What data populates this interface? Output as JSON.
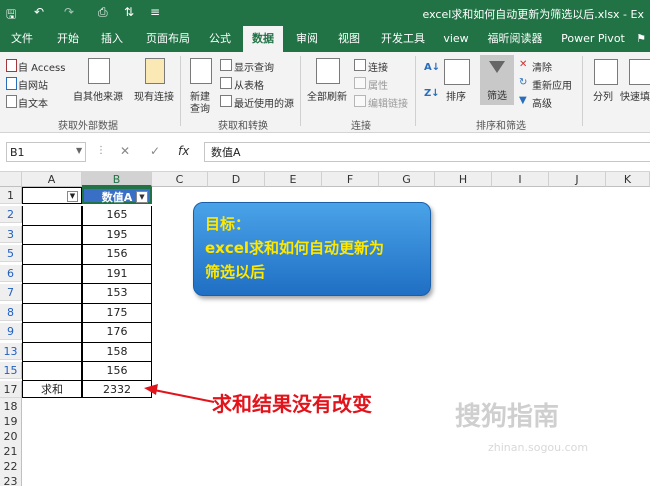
{
  "title_bar": {
    "title": "excel求和如何自动更新为筛选以后.xlsx - Ex"
  },
  "tabs": [
    "文件",
    "开始",
    "插入",
    "页面布局",
    "公式",
    "数据",
    "审阅",
    "视图",
    "开发工具",
    "view",
    "福昕阅读器",
    "Power Pivot"
  ],
  "active_tab": "数据",
  "ribbon": {
    "get_external": {
      "access": "自 Access",
      "web": "自网站",
      "text": "自文本",
      "other": "自其他来源",
      "existing": "现有连接",
      "label": "获取外部数据"
    },
    "get_transform": {
      "new_query": "新建",
      "new_query2": "查询",
      "show_queries": "显示查询",
      "from_table": "从表格",
      "recent": "最近使用的源",
      "label": "获取和转换"
    },
    "connections": {
      "refresh_all": "全部刷新",
      "connections": "连接",
      "properties": "属性",
      "edit_links": "编辑链接",
      "label": "连接"
    },
    "sort_filter": {
      "sort": "排序",
      "filter": "筛选",
      "clear": "清除",
      "reapply": "重新应用",
      "advanced": "高级",
      "label": "排序和筛选"
    },
    "data_tools": {
      "text_to_columns": "分列",
      "flash_fill": "快速填"
    }
  },
  "formula_bar": {
    "name_box": "B1",
    "fx": "fx",
    "formula": "数值A"
  },
  "columns": [
    "A",
    "B",
    "C",
    "D",
    "E",
    "F",
    "G",
    "H",
    "I",
    "J",
    "K"
  ],
  "rows": [
    "1",
    "2",
    "3",
    "5",
    "6",
    "7",
    "8",
    "9",
    "13",
    "15",
    "17",
    "18",
    "19",
    "20",
    "21",
    "22",
    "23"
  ],
  "header_cell": "数值A",
  "values": [
    "165",
    "195",
    "156",
    "191",
    "153",
    "175",
    "176",
    "158",
    "156"
  ],
  "sum_label": "求和",
  "sum_value": "2332",
  "callout": {
    "line1": "目标：",
    "line2": "excel求和如何自动更新为",
    "line3": "筛选以后"
  },
  "annotation": "求和结果没有改变",
  "watermark": {
    "line1": "搜狗指南",
    "line2": "zhinan.sogou.com"
  },
  "colors": {
    "accent": "#217346",
    "note_red": "#e1141c",
    "callout_text": "#ffe800"
  }
}
